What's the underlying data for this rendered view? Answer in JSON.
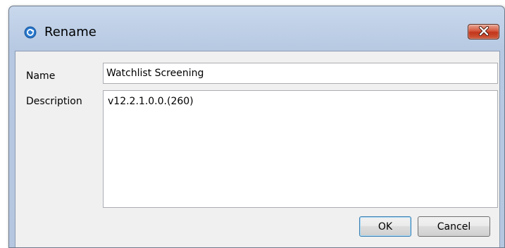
{
  "window": {
    "title": "Rename",
    "title_icon": "refresh-circle-icon",
    "close_icon": "close-icon"
  },
  "form": {
    "name_label": "Name",
    "name_value": "Watchlist Screening",
    "description_label": "Description",
    "description_value": "v12.2.1.0.0.(260)"
  },
  "buttons": {
    "ok_label": "OK",
    "cancel_label": "Cancel"
  },
  "colors": {
    "frame": "#bfd0e7",
    "client_bg": "#f0f0f0",
    "close_button": "#c1351b",
    "default_button_border": "#3c7fb1",
    "title_icon": "#1f5fa8"
  }
}
